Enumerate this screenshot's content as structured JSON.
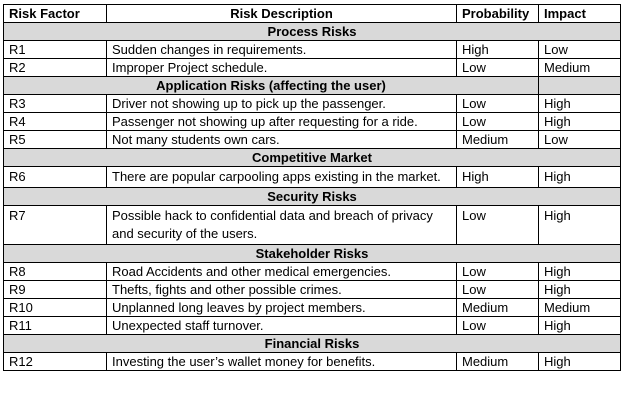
{
  "headers": {
    "factor": "Risk Factor",
    "description": "Risk Description",
    "probability": "Probability",
    "impact": "Impact"
  },
  "sections": [
    {
      "title": "Process Risks",
      "rows": [
        {
          "factor": "R1",
          "description": "Sudden changes in requirements.",
          "probability": "High",
          "impact": "Low"
        },
        {
          "factor": "R2",
          "description": "Improper Project schedule.",
          "probability": "Low",
          "impact": "Medium"
        }
      ]
    },
    {
      "title": "Application Risks (affecting the user)",
      "rows": [
        {
          "factor": "R3",
          "description": "Driver not showing up to pick up the passenger.",
          "probability": "Low",
          "impact": "High"
        },
        {
          "factor": "R4",
          "description": "Passenger not showing up after requesting for a ride.",
          "probability": "Low",
          "impact": "High"
        },
        {
          "factor": "R5",
          "description": "Not many students own cars.",
          "probability": "Medium",
          "impact": "Low"
        }
      ]
    },
    {
      "title": "Competitive Market",
      "rows": [
        {
          "factor": "R6",
          "description": "There are popular carpooling apps existing in the market.",
          "probability": "High",
          "impact": "High"
        }
      ]
    },
    {
      "title": "Security Risks",
      "rows": [
        {
          "factor": "R7",
          "description": "Possible hack to confidential data and breach of privacy and security of the users.",
          "probability": "Low",
          "impact": "High"
        }
      ]
    },
    {
      "title": "Stakeholder Risks",
      "rows": [
        {
          "factor": "R8",
          "description": "Road Accidents and other medical emergencies.",
          "probability": "Low",
          "impact": "High"
        },
        {
          "factor": "R9",
          "description": "Thefts, fights and other possible crimes.",
          "probability": "Low",
          "impact": "High"
        },
        {
          "factor": "R10",
          "description": "Unplanned long leaves by project members.",
          "probability": "Medium",
          "impact": "Medium"
        },
        {
          "factor": "R11",
          "description": "Unexpected staff turnover.",
          "probability": "Low",
          "impact": "High"
        }
      ]
    },
    {
      "title": "Financial Risks",
      "rows": [
        {
          "factor": "R12",
          "description": "Investing the user’s wallet money for benefits.",
          "probability": "Medium",
          "impact": "High"
        }
      ]
    }
  ]
}
